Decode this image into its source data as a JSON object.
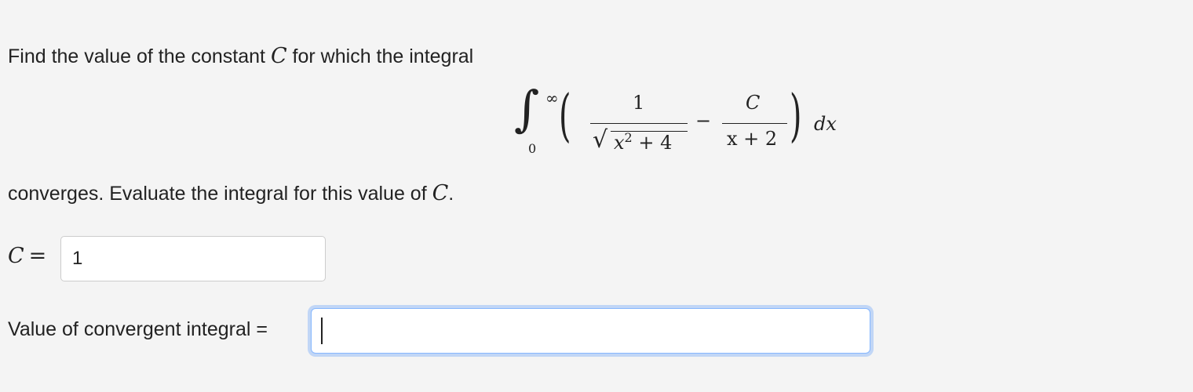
{
  "problem": {
    "prompt_before": "Find the value of the constant ",
    "prompt_var": "C",
    "prompt_after": " for which the integral",
    "converges_before": "converges. Evaluate the integral for this value of ",
    "converges_var": "C",
    "converges_after": "."
  },
  "equation": {
    "integral_sign": "∫",
    "upper_limit": "∞",
    "lower_limit": "0",
    "left_paren": "(",
    "frac1_numerator": "1",
    "sqrt_symbol": "√",
    "frac1_den_var": "x",
    "frac1_den_exp": "2",
    "frac1_den_rest": " + 4",
    "minus": "−",
    "frac2_numerator": "C",
    "frac2_denominator": "x + 2",
    "right_paren": ")",
    "differential": "dx"
  },
  "answer_c": {
    "label_var": "C",
    "label_eq": "=",
    "value": "1"
  },
  "answer_value": {
    "label": "Value of convergent integral =",
    "value": ""
  }
}
